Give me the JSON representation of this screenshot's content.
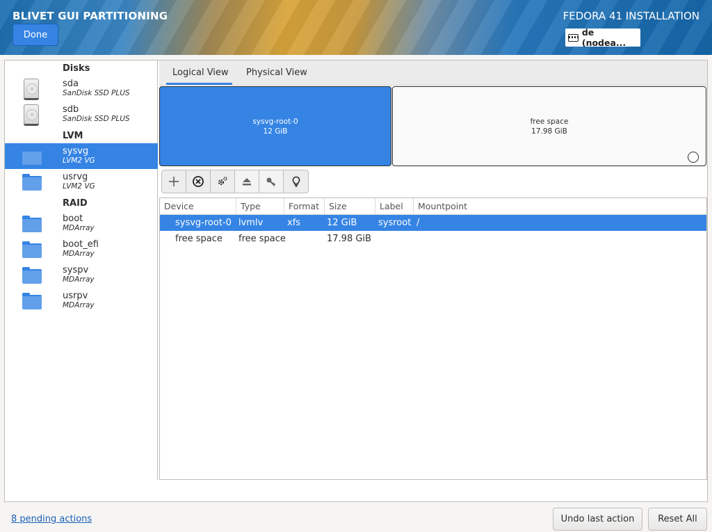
{
  "header": {
    "app_title": "BLIVET GUI PARTITIONING",
    "done_label": "Done",
    "install_title": "FEDORA 41 INSTALLATION",
    "keyboard_layout": "de (nodea..."
  },
  "sidebar": {
    "sections": {
      "disks": "Disks",
      "lvm": "LVM",
      "raid": "RAID"
    },
    "disks": [
      {
        "name": "sda",
        "sub": "SanDisk SSD PLUS",
        "icon": "hard-disk-icon"
      },
      {
        "name": "sdb",
        "sub": "SanDisk SSD PLUS",
        "icon": "hard-disk-icon"
      }
    ],
    "lvm": [
      {
        "name": "sysvg",
        "sub": "LVM2 VG",
        "icon": "folder-icon",
        "selected": true
      },
      {
        "name": "usrvg",
        "sub": "LVM2 VG",
        "icon": "folder-icon"
      }
    ],
    "raid": [
      {
        "name": "boot",
        "sub": "MDArray",
        "icon": "folder-icon"
      },
      {
        "name": "boot_efi",
        "sub": "MDArray",
        "icon": "folder-icon"
      },
      {
        "name": "syspv",
        "sub": "MDArray",
        "icon": "folder-icon"
      },
      {
        "name": "usrpv",
        "sub": "MDArray",
        "icon": "folder-icon"
      }
    ]
  },
  "tabs": {
    "logical": "Logical View",
    "physical": "Physical View",
    "active": "logical"
  },
  "blocks": {
    "root": {
      "name": "sysvg-root-0",
      "size": "12 GiB"
    },
    "free": {
      "name": "free space",
      "size": "17.98 GiB"
    }
  },
  "toolbar": {
    "tools": [
      "add-icon",
      "delete-icon",
      "settings-icon",
      "unmount-icon",
      "decrypt-icon",
      "info-icon"
    ]
  },
  "table": {
    "columns": [
      "Device",
      "Type",
      "Format",
      "Size",
      "Label",
      "Mountpoint"
    ],
    "rows": [
      {
        "device": "sysvg-root-0",
        "type": "lvmlv",
        "format": "xfs",
        "size": "12 GiB",
        "label": "sysroot",
        "mountpoint": "/",
        "selected": true
      },
      {
        "device": "free space",
        "type": "free space",
        "format": "",
        "size": "17.98 GiB",
        "label": "",
        "mountpoint": ""
      }
    ]
  },
  "footer": {
    "pending": "8 pending actions",
    "undo": "Undo last action",
    "reset": "Reset All"
  },
  "colors": {
    "accent": "#3584e4",
    "link": "#1a5fb4"
  }
}
